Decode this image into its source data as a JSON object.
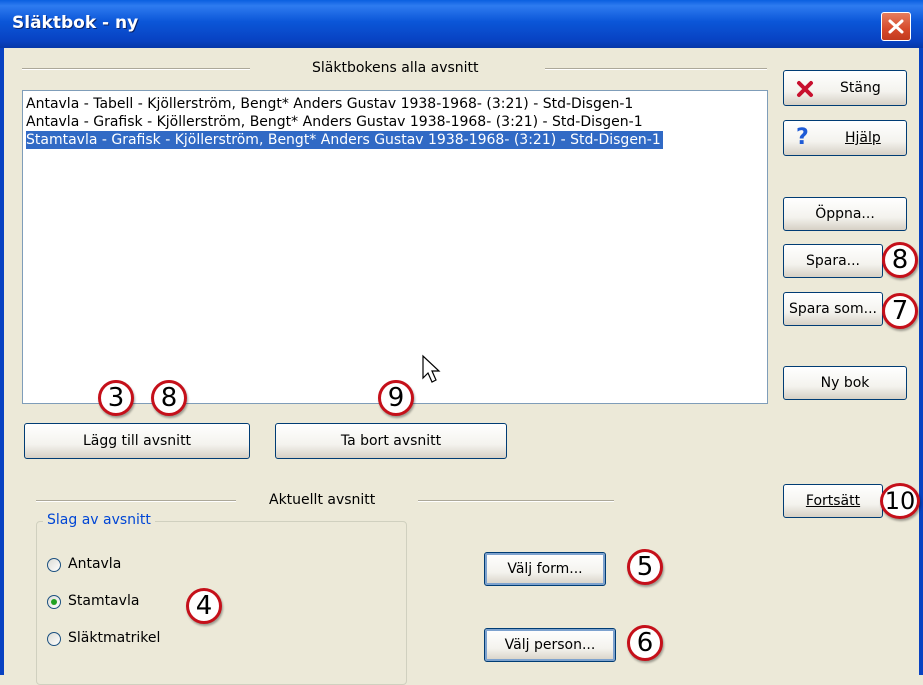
{
  "window": {
    "title": "Släktbok - ny"
  },
  "sections_group": {
    "title": "Släktbokens alla avsnitt"
  },
  "list": {
    "items": [
      "Antavla - Tabell - Kjöllerström, Bengt* Anders Gustav 1938-1968- (3:21) - Std-Disgen-1",
      "Antavla - Grafisk - Kjöllerström, Bengt* Anders Gustav 1938-1968- (3:21) - Std-Disgen-1",
      "Stamtavla - Grafisk - Kjöllerström, Bengt* Anders Gustav 1938-1968- (3:21) - Std-Disgen-1"
    ],
    "selected_index": 2
  },
  "buttons": {
    "close": "Stäng",
    "help": "Hjälp",
    "open": "Öppna...",
    "save": "Spara...",
    "save_as": "Spara som...",
    "new_book": "Ny bok",
    "add_section": "Lägg till avsnitt",
    "remove_section": "Ta bort avsnitt",
    "continue": "Fortsätt",
    "choose_form": "Välj form...",
    "choose_person": "Välj person..."
  },
  "current_section": {
    "title": "Aktuellt avsnitt",
    "type_group_title": "Slag av avsnitt",
    "options": [
      "Antavla",
      "Stamtavla",
      "Släktmatrikel"
    ],
    "selected_option": "Stamtavla"
  },
  "callouts": {
    "c3": "3",
    "c8a": "8",
    "c9": "9",
    "c8b": "8",
    "c7": "7",
    "c10": "10",
    "c4": "4",
    "c5": "5",
    "c6": "6"
  },
  "colors": {
    "titlebar": "#0842C2",
    "selection": "#316AC5",
    "callout_border": "#C5101A",
    "group_title": "#0046D5"
  }
}
